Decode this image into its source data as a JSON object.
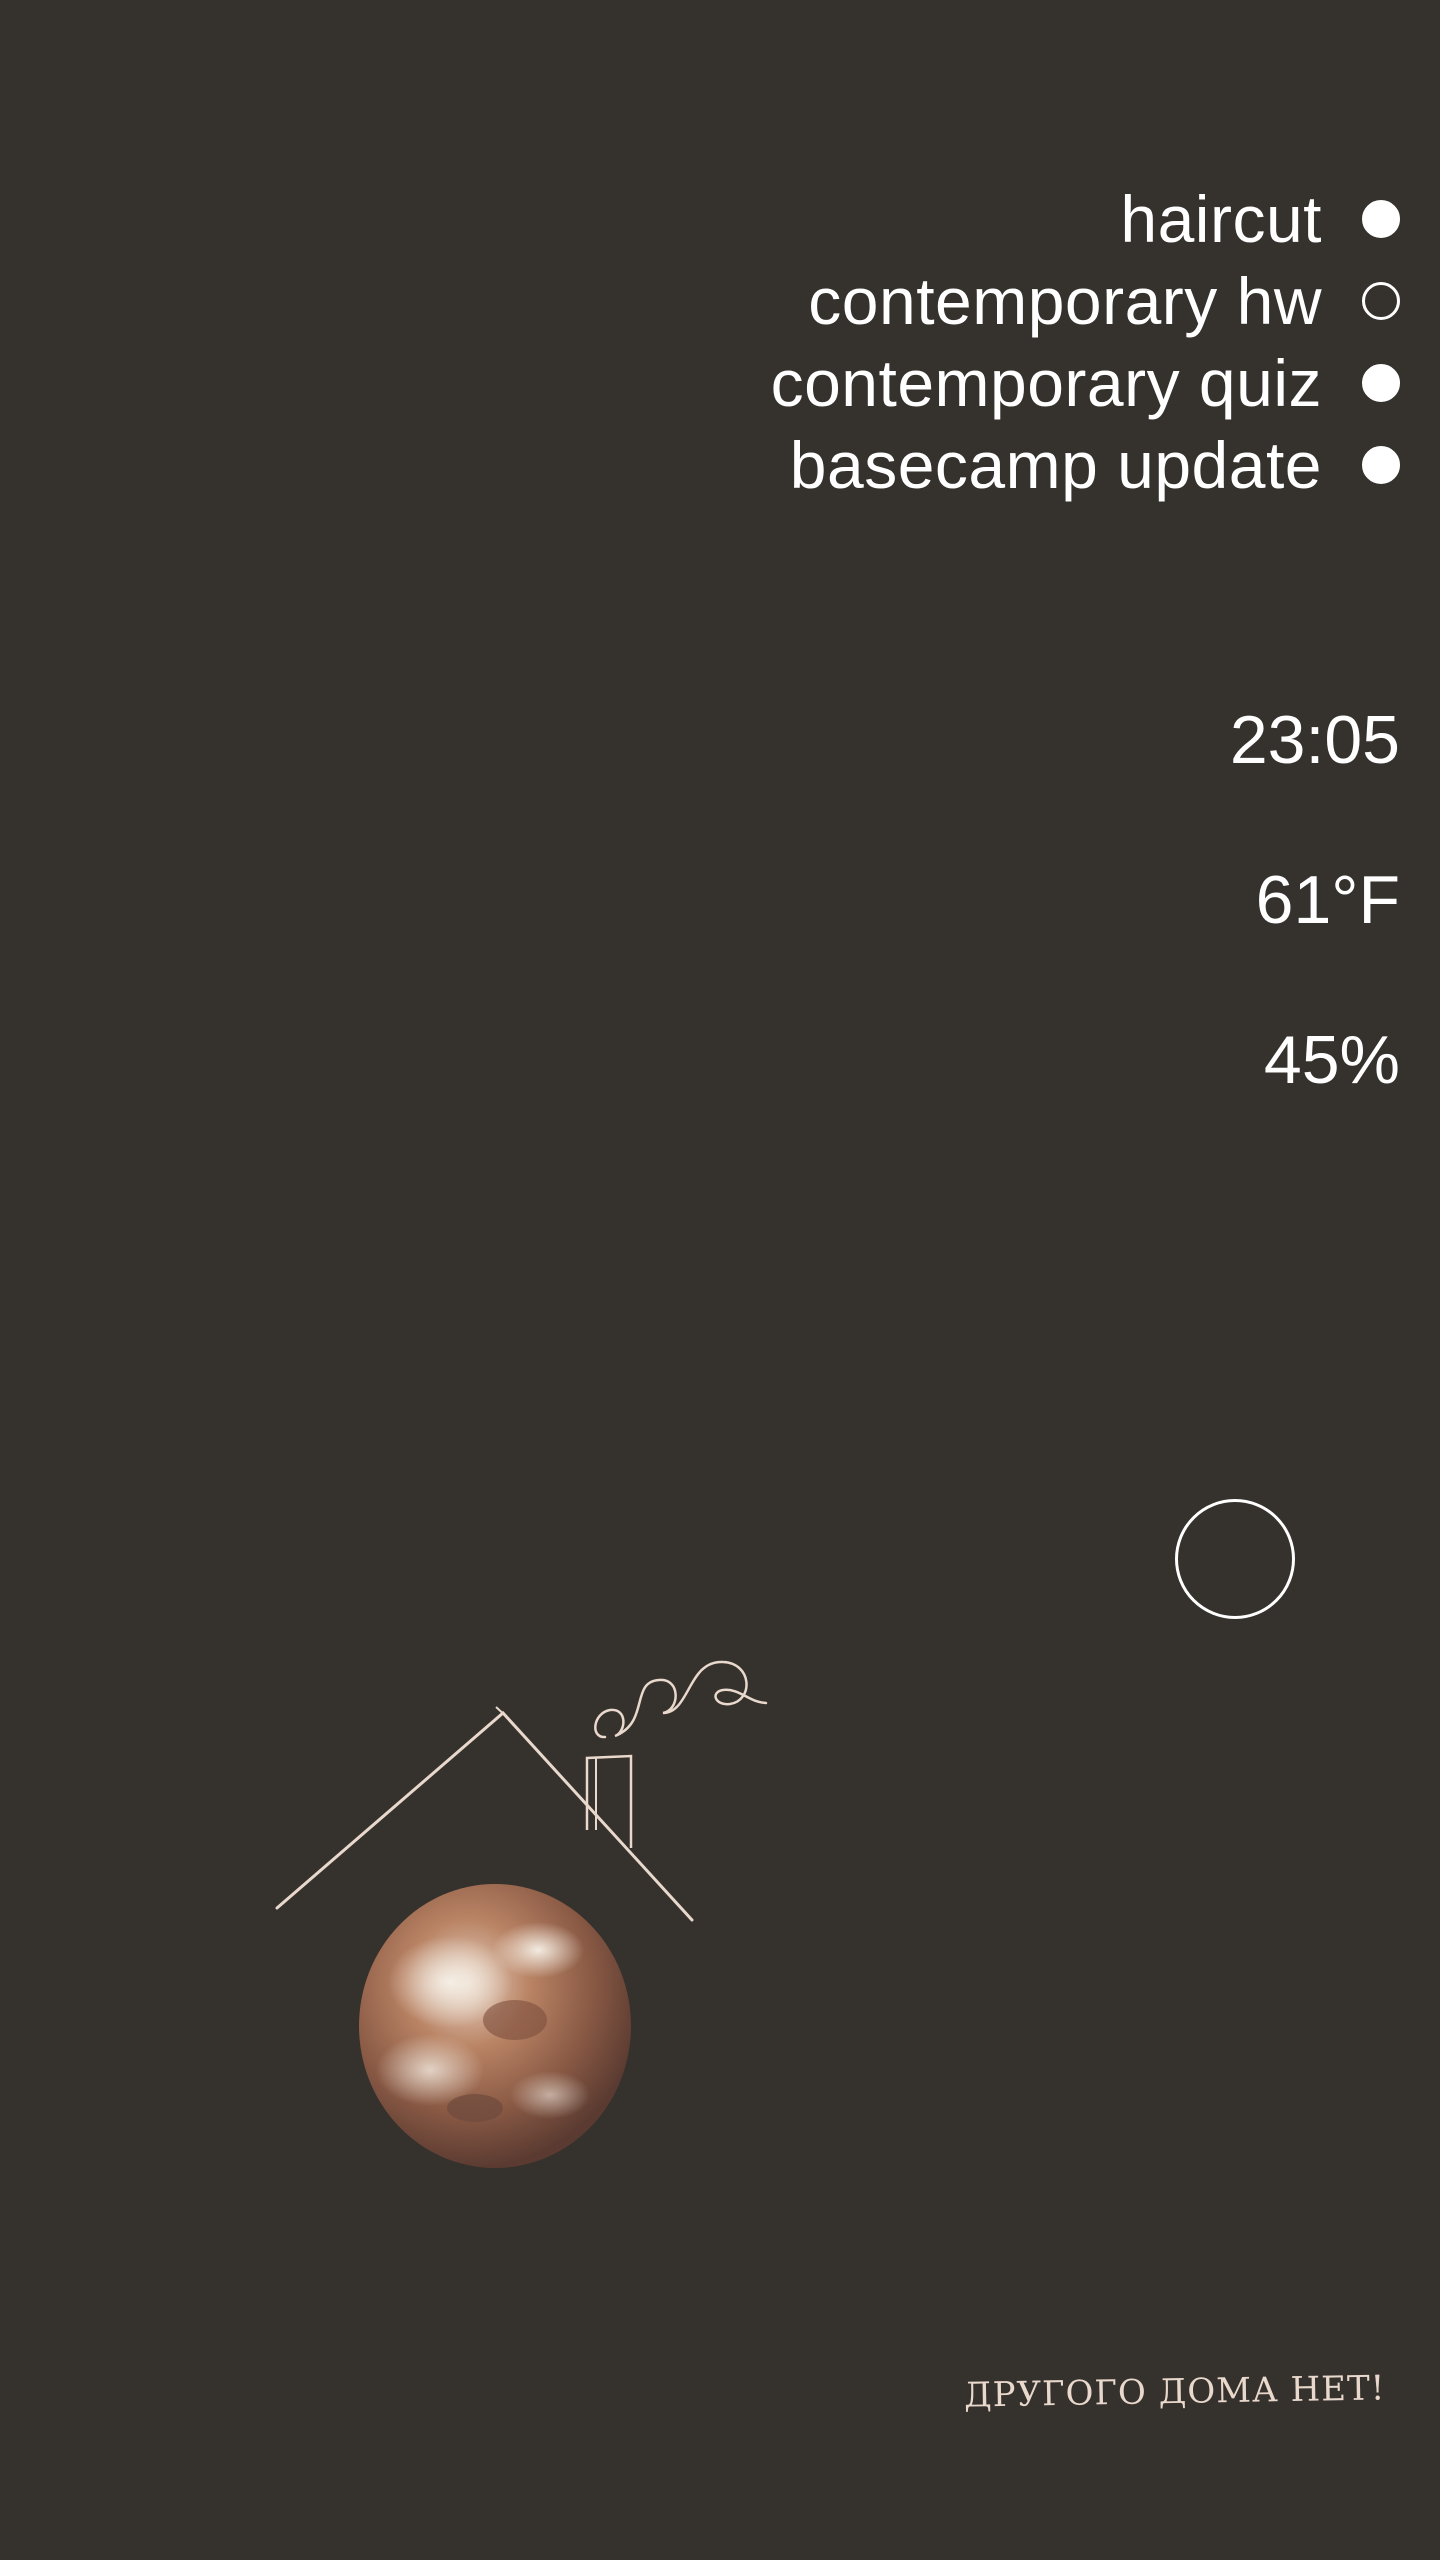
{
  "todos": [
    {
      "label": "haircut",
      "done": true
    },
    {
      "label": "contemporary hw",
      "done": false
    },
    {
      "label": "contemporary quiz",
      "done": true
    },
    {
      "label": "basecamp update",
      "done": true
    }
  ],
  "status": {
    "time": "23:05",
    "temperature": "61°F",
    "battery": "45%"
  },
  "illustration": {
    "icon": "house-roof-with-planet"
  },
  "slogan": "ДРУГОГО ДОМА НЕТ!",
  "colors": {
    "background": "#35312d",
    "text": "#ffffff",
    "sketch": "#e9d8cc"
  }
}
